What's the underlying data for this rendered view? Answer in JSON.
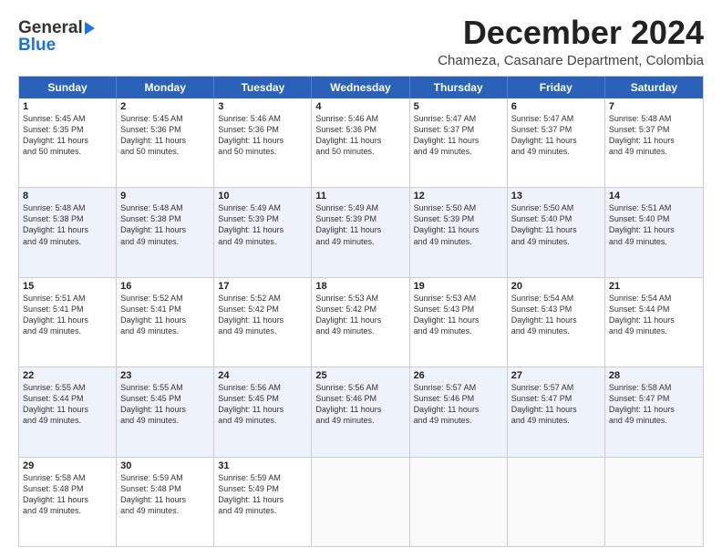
{
  "logo": {
    "line1": "General",
    "line2": "Blue"
  },
  "title": "December 2024",
  "subtitle": "Chameza, Casanare Department, Colombia",
  "header_days": [
    "Sunday",
    "Monday",
    "Tuesday",
    "Wednesday",
    "Thursday",
    "Friday",
    "Saturday"
  ],
  "weeks": [
    [
      {
        "day": "1",
        "lines": [
          "Sunrise: 5:45 AM",
          "Sunset: 5:35 PM",
          "Daylight: 11 hours",
          "and 50 minutes."
        ]
      },
      {
        "day": "2",
        "lines": [
          "Sunrise: 5:45 AM",
          "Sunset: 5:36 PM",
          "Daylight: 11 hours",
          "and 50 minutes."
        ]
      },
      {
        "day": "3",
        "lines": [
          "Sunrise: 5:46 AM",
          "Sunset: 5:36 PM",
          "Daylight: 11 hours",
          "and 50 minutes."
        ]
      },
      {
        "day": "4",
        "lines": [
          "Sunrise: 5:46 AM",
          "Sunset: 5:36 PM",
          "Daylight: 11 hours",
          "and 50 minutes."
        ]
      },
      {
        "day": "5",
        "lines": [
          "Sunrise: 5:47 AM",
          "Sunset: 5:37 PM",
          "Daylight: 11 hours",
          "and 49 minutes."
        ]
      },
      {
        "day": "6",
        "lines": [
          "Sunrise: 5:47 AM",
          "Sunset: 5:37 PM",
          "Daylight: 11 hours",
          "and 49 minutes."
        ]
      },
      {
        "day": "7",
        "lines": [
          "Sunrise: 5:48 AM",
          "Sunset: 5:37 PM",
          "Daylight: 11 hours",
          "and 49 minutes."
        ]
      }
    ],
    [
      {
        "day": "8",
        "lines": [
          "Sunrise: 5:48 AM",
          "Sunset: 5:38 PM",
          "Daylight: 11 hours",
          "and 49 minutes."
        ]
      },
      {
        "day": "9",
        "lines": [
          "Sunrise: 5:48 AM",
          "Sunset: 5:38 PM",
          "Daylight: 11 hours",
          "and 49 minutes."
        ]
      },
      {
        "day": "10",
        "lines": [
          "Sunrise: 5:49 AM",
          "Sunset: 5:39 PM",
          "Daylight: 11 hours",
          "and 49 minutes."
        ]
      },
      {
        "day": "11",
        "lines": [
          "Sunrise: 5:49 AM",
          "Sunset: 5:39 PM",
          "Daylight: 11 hours",
          "and 49 minutes."
        ]
      },
      {
        "day": "12",
        "lines": [
          "Sunrise: 5:50 AM",
          "Sunset: 5:39 PM",
          "Daylight: 11 hours",
          "and 49 minutes."
        ]
      },
      {
        "day": "13",
        "lines": [
          "Sunrise: 5:50 AM",
          "Sunset: 5:40 PM",
          "Daylight: 11 hours",
          "and 49 minutes."
        ]
      },
      {
        "day": "14",
        "lines": [
          "Sunrise: 5:51 AM",
          "Sunset: 5:40 PM",
          "Daylight: 11 hours",
          "and 49 minutes."
        ]
      }
    ],
    [
      {
        "day": "15",
        "lines": [
          "Sunrise: 5:51 AM",
          "Sunset: 5:41 PM",
          "Daylight: 11 hours",
          "and 49 minutes."
        ]
      },
      {
        "day": "16",
        "lines": [
          "Sunrise: 5:52 AM",
          "Sunset: 5:41 PM",
          "Daylight: 11 hours",
          "and 49 minutes."
        ]
      },
      {
        "day": "17",
        "lines": [
          "Sunrise: 5:52 AM",
          "Sunset: 5:42 PM",
          "Daylight: 11 hours",
          "and 49 minutes."
        ]
      },
      {
        "day": "18",
        "lines": [
          "Sunrise: 5:53 AM",
          "Sunset: 5:42 PM",
          "Daylight: 11 hours",
          "and 49 minutes."
        ]
      },
      {
        "day": "19",
        "lines": [
          "Sunrise: 5:53 AM",
          "Sunset: 5:43 PM",
          "Daylight: 11 hours",
          "and 49 minutes."
        ]
      },
      {
        "day": "20",
        "lines": [
          "Sunrise: 5:54 AM",
          "Sunset: 5:43 PM",
          "Daylight: 11 hours",
          "and 49 minutes."
        ]
      },
      {
        "day": "21",
        "lines": [
          "Sunrise: 5:54 AM",
          "Sunset: 5:44 PM",
          "Daylight: 11 hours",
          "and 49 minutes."
        ]
      }
    ],
    [
      {
        "day": "22",
        "lines": [
          "Sunrise: 5:55 AM",
          "Sunset: 5:44 PM",
          "Daylight: 11 hours",
          "and 49 minutes."
        ]
      },
      {
        "day": "23",
        "lines": [
          "Sunrise: 5:55 AM",
          "Sunset: 5:45 PM",
          "Daylight: 11 hours",
          "and 49 minutes."
        ]
      },
      {
        "day": "24",
        "lines": [
          "Sunrise: 5:56 AM",
          "Sunset: 5:45 PM",
          "Daylight: 11 hours",
          "and 49 minutes."
        ]
      },
      {
        "day": "25",
        "lines": [
          "Sunrise: 5:56 AM",
          "Sunset: 5:46 PM",
          "Daylight: 11 hours",
          "and 49 minutes."
        ]
      },
      {
        "day": "26",
        "lines": [
          "Sunrise: 5:57 AM",
          "Sunset: 5:46 PM",
          "Daylight: 11 hours",
          "and 49 minutes."
        ]
      },
      {
        "day": "27",
        "lines": [
          "Sunrise: 5:57 AM",
          "Sunset: 5:47 PM",
          "Daylight: 11 hours",
          "and 49 minutes."
        ]
      },
      {
        "day": "28",
        "lines": [
          "Sunrise: 5:58 AM",
          "Sunset: 5:47 PM",
          "Daylight: 11 hours",
          "and 49 minutes."
        ]
      }
    ],
    [
      {
        "day": "29",
        "lines": [
          "Sunrise: 5:58 AM",
          "Sunset: 5:48 PM",
          "Daylight: 11 hours",
          "and 49 minutes."
        ]
      },
      {
        "day": "30",
        "lines": [
          "Sunrise: 5:59 AM",
          "Sunset: 5:48 PM",
          "Daylight: 11 hours",
          "and 49 minutes."
        ]
      },
      {
        "day": "31",
        "lines": [
          "Sunrise: 5:59 AM",
          "Sunset: 5:49 PM",
          "Daylight: 11 hours",
          "and 49 minutes."
        ]
      },
      {
        "day": "",
        "lines": []
      },
      {
        "day": "",
        "lines": []
      },
      {
        "day": "",
        "lines": []
      },
      {
        "day": "",
        "lines": []
      }
    ]
  ]
}
